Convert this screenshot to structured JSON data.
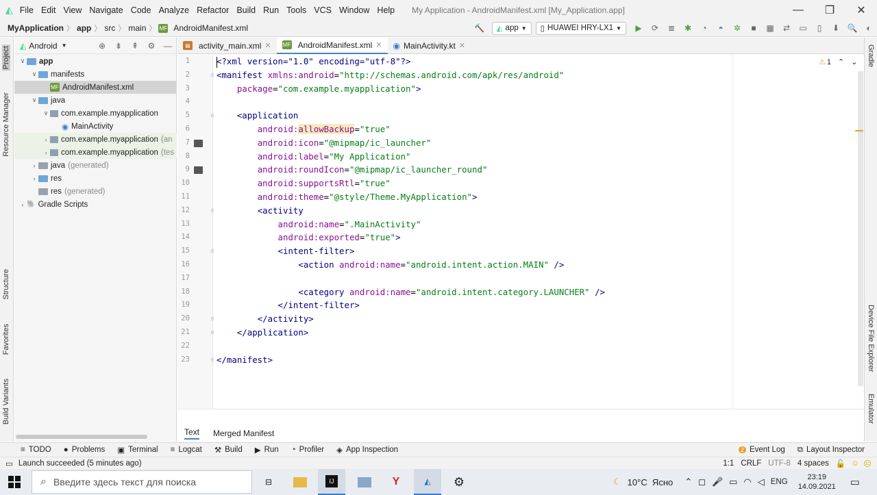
{
  "window": {
    "menu": [
      "File",
      "Edit",
      "View",
      "Navigate",
      "Code",
      "Analyze",
      "Refactor",
      "Build",
      "Run",
      "Tools",
      "VCS",
      "Window",
      "Help"
    ],
    "title": "My Application - AndroidManifest.xml [My_Application.app]"
  },
  "breadcrumb": [
    "MyApplication",
    "app",
    "src",
    "main",
    "AndroidManifest.xml"
  ],
  "toolbar": {
    "config": "app",
    "device": "HUAWEI HRY-LX1"
  },
  "left_tools": [
    "Project",
    "Resource Manager",
    "Structure",
    "Favorites",
    "Build Variants"
  ],
  "right_tools": [
    "Gradle",
    "Device File Explorer",
    "Emulator"
  ],
  "project": {
    "view": "Android",
    "tree": [
      {
        "label": "app",
        "suffix": ""
      },
      {
        "label": "manifests",
        "suffix": ""
      },
      {
        "label": "AndroidManifest.xml",
        "suffix": ""
      },
      {
        "label": "java",
        "suffix": ""
      },
      {
        "label": "com.example.myapplication",
        "suffix": ""
      },
      {
        "label": "MainActivity",
        "suffix": ""
      },
      {
        "label": "com.example.myapplication",
        "suffix": "(an"
      },
      {
        "label": "com.example.myapplication",
        "suffix": "(tes"
      },
      {
        "label": "java",
        "suffix": "(generated)"
      },
      {
        "label": "res",
        "suffix": ""
      },
      {
        "label": "res",
        "suffix": "(generated)"
      },
      {
        "label": "Gradle Scripts",
        "suffix": ""
      }
    ]
  },
  "tabs": [
    "activity_main.xml",
    "AndroidManifest.xml",
    "MainActivity.kt"
  ],
  "inspection": "1",
  "line_numbers": [
    "1",
    "2",
    "3",
    "4",
    "5",
    "6",
    "7",
    "8",
    "9",
    "10",
    "11",
    "12",
    "13",
    "14",
    "15",
    "16",
    "17",
    "18",
    "19",
    "20",
    "21",
    "22",
    "23"
  ],
  "code": [
    [
      [
        "<?xml version=\"1.0\" encoding=\"utf-8\"?>",
        "t"
      ]
    ],
    [
      [
        "<manifest ",
        "t"
      ],
      [
        "xmlns:android",
        "an"
      ],
      [
        "=",
        ""
      ],
      [
        "\"http://schemas.android.com/apk/res/android\"",
        "av"
      ]
    ],
    [
      [
        "    ",
        ""
      ],
      [
        "package",
        "an"
      ],
      [
        "=",
        ""
      ],
      [
        "\"com.example.myapplication\"",
        "av"
      ],
      [
        ">",
        "t"
      ]
    ],
    [],
    [
      [
        "    ",
        ""
      ],
      [
        "<application",
        "t"
      ]
    ],
    [
      [
        "        ",
        ""
      ],
      [
        "android:",
        "an"
      ],
      [
        "allowBackup",
        "an hl"
      ],
      [
        "=",
        ""
      ],
      [
        "\"true\"",
        "av"
      ]
    ],
    [
      [
        "        ",
        ""
      ],
      [
        "android:icon",
        "an"
      ],
      [
        "=",
        ""
      ],
      [
        "\"@mipmap/ic_launcher\"",
        "av"
      ]
    ],
    [
      [
        "        ",
        ""
      ],
      [
        "android:label",
        "an"
      ],
      [
        "=",
        ""
      ],
      [
        "\"My Application\"",
        "av"
      ]
    ],
    [
      [
        "        ",
        ""
      ],
      [
        "android:roundIcon",
        "an"
      ],
      [
        "=",
        ""
      ],
      [
        "\"@mipmap/ic_launcher_round\"",
        "av"
      ]
    ],
    [
      [
        "        ",
        ""
      ],
      [
        "android:supportsRtl",
        "an"
      ],
      [
        "=",
        ""
      ],
      [
        "\"true\"",
        "av"
      ]
    ],
    [
      [
        "        ",
        ""
      ],
      [
        "android:theme",
        "an"
      ],
      [
        "=",
        ""
      ],
      [
        "\"@style/Theme.MyApplication\"",
        "av"
      ],
      [
        ">",
        "t"
      ]
    ],
    [
      [
        "        ",
        ""
      ],
      [
        "<activity",
        "t"
      ]
    ],
    [
      [
        "            ",
        ""
      ],
      [
        "android:name",
        "an"
      ],
      [
        "=",
        ""
      ],
      [
        "\".MainActivity\"",
        "av"
      ]
    ],
    [
      [
        "            ",
        ""
      ],
      [
        "android:exported",
        "an"
      ],
      [
        "=",
        ""
      ],
      [
        "\"true\"",
        "av"
      ],
      [
        ">",
        "t"
      ]
    ],
    [
      [
        "            ",
        ""
      ],
      [
        "<intent-filter>",
        "t"
      ]
    ],
    [
      [
        "                ",
        ""
      ],
      [
        "<action ",
        "t"
      ],
      [
        "android:name",
        "an"
      ],
      [
        "=",
        ""
      ],
      [
        "\"android.intent.action.MAIN\"",
        "av"
      ],
      [
        " />",
        "t"
      ]
    ],
    [],
    [
      [
        "                ",
        ""
      ],
      [
        "<category ",
        "t"
      ],
      [
        "android:name",
        "an"
      ],
      [
        "=",
        ""
      ],
      [
        "\"android.intent.category.LAUNCHER\"",
        "av"
      ],
      [
        " />",
        "t"
      ]
    ],
    [
      [
        "            ",
        ""
      ],
      [
        "</intent-filter>",
        "t"
      ]
    ],
    [
      [
        "        ",
        ""
      ],
      [
        "</activity>",
        "t"
      ]
    ],
    [
      [
        "    ",
        ""
      ],
      [
        "</application>",
        "t"
      ]
    ],
    [],
    [
      [
        "</manifest>",
        "t"
      ]
    ]
  ],
  "editor_bottom_tabs": [
    "Text",
    "Merged Manifest"
  ],
  "tool_windows": [
    "TODO",
    "Problems",
    "Terminal",
    "Logcat",
    "Build",
    "Run",
    "Profiler",
    "App Inspection"
  ],
  "tool_windows_right": {
    "event_log": "Event Log",
    "event_badge": "2",
    "layout_inspector": "Layout Inspector"
  },
  "status": {
    "message": "Launch succeeded (5 minutes ago)",
    "position": "1:1",
    "line_sep": "CRLF",
    "encoding": "UTF-8",
    "indent": "4 spaces"
  },
  "taskbar": {
    "search_placeholder": "Введите здесь текст для поиска",
    "weather": "10°C  Ясно",
    "lang": "ENG",
    "time": "23:19",
    "date": "14.09.2021"
  }
}
